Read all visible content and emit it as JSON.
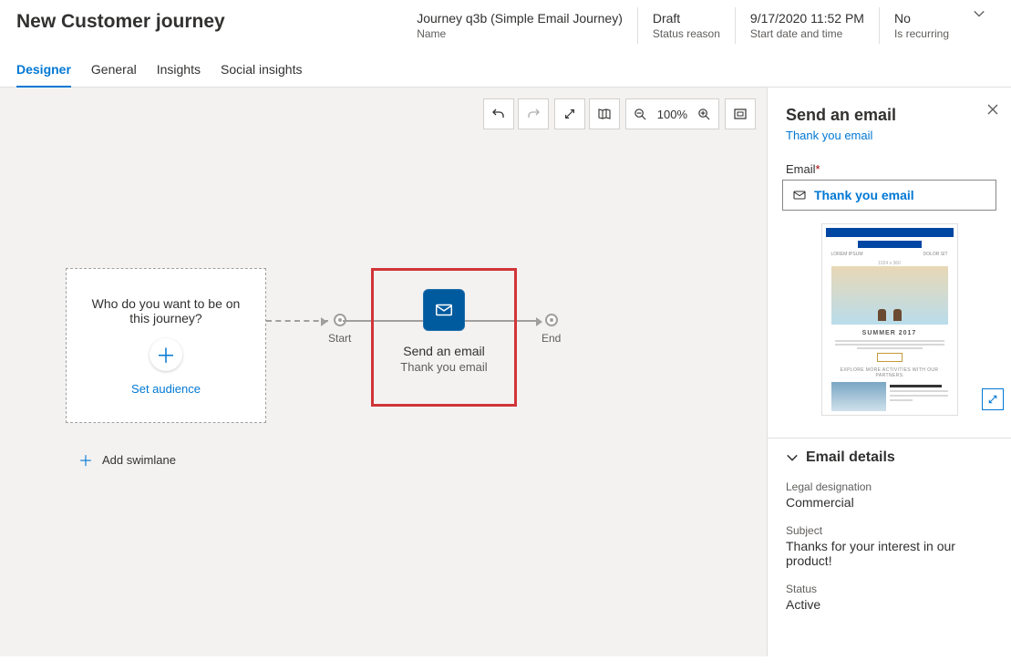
{
  "header": {
    "page_title": "New Customer journey",
    "meta": [
      {
        "value": "Journey q3b (Simple Email Journey)",
        "label": "Name"
      },
      {
        "value": "Draft",
        "label": "Status reason"
      },
      {
        "value": "9/17/2020 11:52 PM",
        "label": "Start date and time"
      },
      {
        "value": "No",
        "label": "Is recurring"
      }
    ]
  },
  "tabs": [
    "Designer",
    "General",
    "Insights",
    "Social insights"
  ],
  "toolbar": {
    "zoom": "100%"
  },
  "canvas": {
    "audience_prompt": "Who do you want to be on this journey?",
    "set_audience": "Set audience",
    "start_label": "Start",
    "end_label": "End",
    "email_tile": {
      "title": "Send an email",
      "subtitle": "Thank you email"
    },
    "add_swimlane": "Add swimlane"
  },
  "panel": {
    "title": "Send an email",
    "link": "Thank you email",
    "field_label": "Email",
    "selected_email": "Thank you email",
    "preview": {
      "heading": "SUMMER 2017",
      "tagline": "EXPLORE MORE ACTIVITIES WITH OUR PARTNERS"
    },
    "details_header": "Email details",
    "details": {
      "legal_label": "Legal designation",
      "legal_value": "Commercial",
      "subject_label": "Subject",
      "subject_value": "Thanks for your interest in our product!",
      "status_label": "Status",
      "status_value": "Active"
    }
  }
}
